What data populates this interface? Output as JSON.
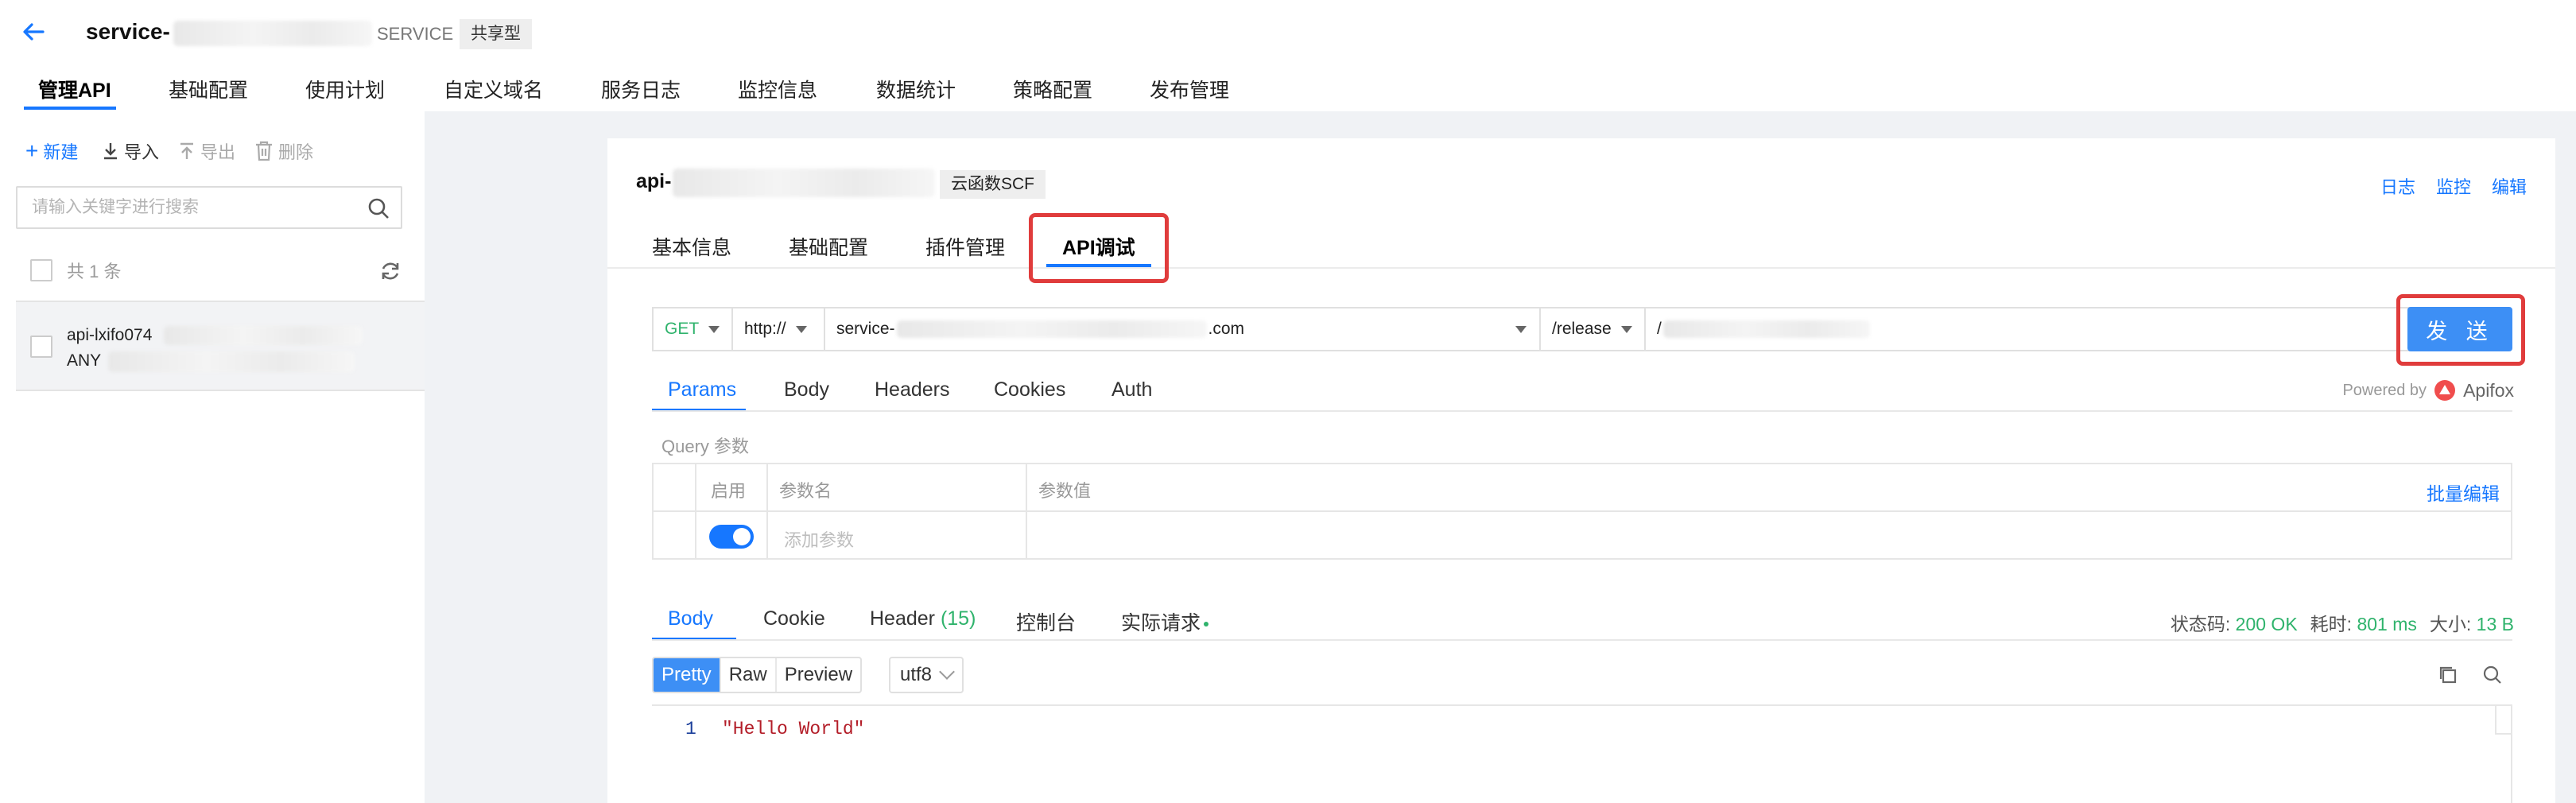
{
  "header": {
    "service_name": "service-",
    "service_suffix": "SERVICE",
    "shared_badge": "共享型"
  },
  "main_tabs": [
    {
      "label": "管理API",
      "active": true
    },
    {
      "label": "基础配置"
    },
    {
      "label": "使用计划"
    },
    {
      "label": "自定义域名"
    },
    {
      "label": "服务日志"
    },
    {
      "label": "监控信息"
    },
    {
      "label": "数据统计"
    },
    {
      "label": "策略配置"
    },
    {
      "label": "发布管理"
    }
  ],
  "sidebar": {
    "new_label": "新建",
    "import_label": "导入",
    "export_label": "导出",
    "delete_label": "删除",
    "search_placeholder": "请输入关键字进行搜索",
    "count_label": "共 1 条",
    "api_item": {
      "name": "api-lxifo074",
      "method": "ANY"
    }
  },
  "card": {
    "api_prefix": "api-",
    "backend_badge": "云函数SCF",
    "links": [
      "日志",
      "监控",
      "编辑"
    ],
    "tabs": [
      "基本信息",
      "基础配置",
      "插件管理",
      "API调试"
    ],
    "active_tab": "API调试"
  },
  "request": {
    "method": "GET",
    "protocol": "http://",
    "host_prefix": "service-",
    "host_suffix": ".com",
    "stage": "/release",
    "path_prefix": "/",
    "send_label": "发 送"
  },
  "params_tabs": [
    "Params",
    "Body",
    "Headers",
    "Cookies",
    "Auth"
  ],
  "powered_by": {
    "text": "Powered by",
    "brand": "Apifox"
  },
  "query": {
    "section_label": "Query 参数",
    "col_enabled": "启用",
    "col_name": "参数名",
    "col_value": "参数值",
    "bulk_edit": "批量编辑",
    "add_placeholder": "添加参数",
    "toggle_on": true
  },
  "response": {
    "tabs": {
      "body": "Body",
      "cookie": "Cookie",
      "header": "Header",
      "header_count": "(15)",
      "console": "控制台",
      "actual": "实际请求"
    },
    "status_label": "状态码:",
    "status_value": "200 OK",
    "time_label": "耗时:",
    "time_value": "801 ms",
    "size_label": "大小:",
    "size_value": "13 B",
    "formats": [
      "Pretty",
      "Raw",
      "Preview"
    ],
    "encoding": "utf8",
    "line_number": "1",
    "body_text": "\"Hello World\""
  },
  "colors": {
    "accent": "#1677ff",
    "send_button": "#3d8ff5",
    "success": "#2fb36c",
    "highlight_box": "#e03c3c",
    "json_string": "#b31d28"
  }
}
